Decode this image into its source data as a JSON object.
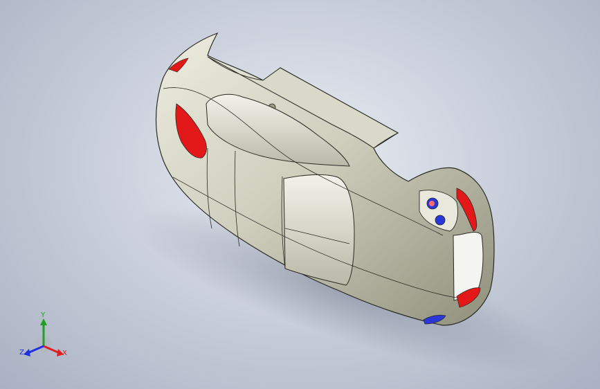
{
  "triad": {
    "y_label": "Y",
    "z_label": "Z",
    "x_label": "X"
  },
  "colors": {
    "body": "#d2d2c2",
    "body_shadow": "#8a8a78",
    "edges": "#2a2a24",
    "accent_red": "#e31919",
    "accent_blue": "#2a36d8",
    "axis_x": "#e02020",
    "axis_y": "#20a020",
    "axis_z": "#2030e0"
  }
}
